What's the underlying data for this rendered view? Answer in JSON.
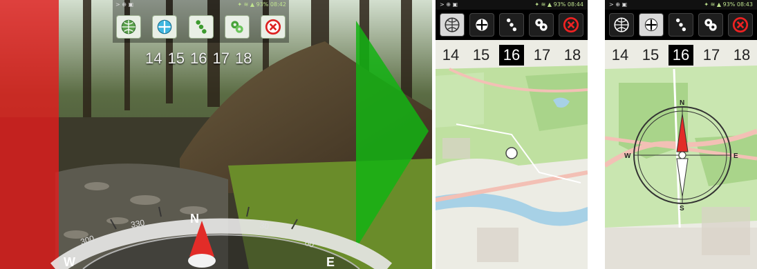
{
  "left": {
    "status_left": ">  ⊕  ▣",
    "status_right": "✦ ≋ ▲ 93% 08:42",
    "zoom_levels": [
      "14",
      "15",
      "16",
      "17",
      "18"
    ],
    "compass_labels": [
      "N",
      "E",
      "W",
      "300",
      "330",
      "30",
      "60"
    ]
  },
  "middle": {
    "status_left": ">  ⊕  ▣",
    "status_right": "✦ ≋ ▲ 93% 08:44",
    "zoom_levels": [
      "14",
      "15",
      "16",
      "17",
      "18"
    ],
    "active_zoom": "16"
  },
  "right": {
    "status_left": ">  ⊕  ▣",
    "status_right": "✦ ≋ ▲ 93% 08:43",
    "zoom_levels": [
      "14",
      "15",
      "16",
      "17",
      "18"
    ],
    "active_zoom": "16",
    "compass_labels": [
      "N",
      "E",
      "S",
      "W"
    ]
  },
  "toolbar_icons": [
    "globe-icon",
    "crosshair-icon",
    "route-icon",
    "gears-icon",
    "close-icon"
  ],
  "colors": {
    "red_overlay": "#e11d1d",
    "green_overlay": "#13b313",
    "map_green": "#b7d98d",
    "map_water": "#a7d1e6",
    "road": "#f3c0b5",
    "needle_red": "#e22c28"
  }
}
